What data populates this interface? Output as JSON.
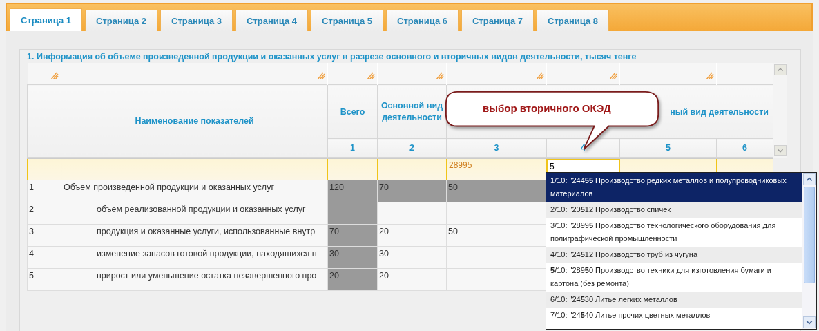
{
  "tabs": [
    {
      "label": "Страница 1",
      "selected": true
    },
    {
      "label": "Страница 2",
      "selected": false
    },
    {
      "label": "Страница 3",
      "selected": false
    },
    {
      "label": "Страница 4",
      "selected": false
    },
    {
      "label": "Страница 5",
      "selected": false
    },
    {
      "label": "Страница 6",
      "selected": false
    },
    {
      "label": "Страница 7",
      "selected": false
    },
    {
      "label": "Страница 8",
      "selected": false
    }
  ],
  "section_title": "1. Информация об объеме произведенной продукции и оказанных услуг в разрезе основного и вторичных видов деятельности, тысяч тенге",
  "table": {
    "headers": {
      "name": "Наименование показателей",
      "total": "Всего",
      "main": "Основной вид деятельности",
      "secondary": "ный вид деятельности"
    },
    "column_numbers": [
      "1",
      "2",
      "3",
      "4",
      "5",
      "6"
    ],
    "input_row": [
      {
        "kind": "empty"
      },
      {
        "kind": "empty"
      },
      {
        "kind": "text",
        "value": "28995"
      },
      {
        "kind": "field",
        "value": "5"
      },
      {
        "kind": "empty"
      },
      {
        "kind": "empty"
      }
    ],
    "rows": [
      {
        "number": "1",
        "name": "Объем произведенной продукции и оказанных услуг",
        "cells": [
          {
            "value": "120",
            "computed": true
          },
          {
            "value": "70",
            "computed": true
          },
          {
            "value": "50",
            "computed": true
          }
        ],
        "children": [
          {
            "number": "2",
            "name": "объем реализованной продукции и оказанных услуг",
            "cells": [
              {
                "computed": true
              },
              {
                "computed": false
              },
              {
                "computed": false
              }
            ]
          },
          {
            "number": "3",
            "name": "продукция и оказанные услуги, использованные внутр",
            "cells": [
              {
                "value": "70",
                "computed": true
              },
              {
                "value": "20",
                "computed": false
              },
              {
                "value": "50",
                "computed": false
              }
            ]
          },
          {
            "number": "4",
            "name": "изменение запасов готовой продукции, находящихся н",
            "cells": [
              {
                "value": "30",
                "computed": true
              },
              {
                "value": "30",
                "computed": false
              },
              {
                "computed": false
              }
            ]
          },
          {
            "number": "5",
            "name": "прирост или уменьшение остатка незавершенного про",
            "cells": [
              {
                "value": "20",
                "computed": true
              },
              {
                "value": "20",
                "computed": false
              },
              {
                "computed": false
              }
            ]
          }
        ]
      }
    ]
  },
  "callout": {
    "text": "выбор вторичного ОКЭД"
  },
  "dropdown": {
    "items": [
      {
        "text": "1/10: \"244**55** Производство редких металлов и полупроводниковых материалов",
        "selected": true
      },
      {
        "text": "2/10: \"20**5**12 Производство спичек",
        "selected": false
      },
      {
        "text": "3/10: \"2899**5** Производство технологического оборудования для полиграфической промышленности",
        "selected": false
      },
      {
        "text": "4/10: \"24**5**12 Производство труб из чугуна",
        "selected": false
      },
      {
        "text": "**5**/10: \"289**5**0 Производство техники для изготовления бумаги и картона (без ремонта)",
        "selected": false
      },
      {
        "text": "6/10: \"24**5**30 Литье легких металлов",
        "selected": false
      },
      {
        "text": "7/10: \"24**5**40 Литье прочих цветных металлов",
        "selected": false
      }
    ]
  }
}
